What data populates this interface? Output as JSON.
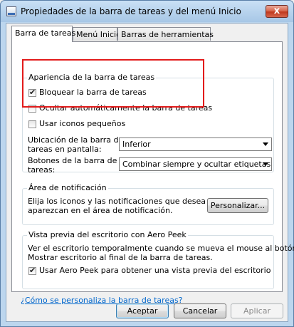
{
  "window": {
    "title": "Propiedades de la barra de tareas y del menú Inicio",
    "close_symbol": "x"
  },
  "tabs": [
    {
      "label": "Barra de tareas",
      "active": true
    },
    {
      "label": "Menú Inicio",
      "active": false
    },
    {
      "label": "Barras de herramientas",
      "active": false
    }
  ],
  "appearance": {
    "group_label": "Apariencia de la barra de tareas",
    "lock_label": "Bloquear la barra de tareas",
    "lock_checked": true,
    "autohide_label": "Ocultar automáticamente la barra de tareas",
    "autohide_checked": false,
    "small_icons_label": "Usar iconos pequeños",
    "small_icons_checked": false,
    "location_label_1": "Ubicación de la barra de",
    "location_label_2": "tareas en pantalla:",
    "location_value": "Inferior",
    "buttons_label_1": "Botones de la barra de",
    "buttons_label_2": "tareas:",
    "buttons_value": "Combinar siempre y ocultar etiquetas"
  },
  "notification": {
    "group_label": "Área de notificación",
    "text_1": "Elija los iconos y las notificaciones que desea que",
    "text_2": "aparezcan en el área de notificación.",
    "customize_button": "Personalizar..."
  },
  "peek": {
    "group_label": "Vista previa del escritorio con Aero Peek",
    "text_1": "Ver el escritorio temporalmente cuando se mueva el mouse al botón",
    "text_2": "Mostrar escritorio al final de la barra de tareas.",
    "use_peek_label": "Usar Aero Peek para obtener una vista previa del escritorio",
    "use_peek_checked": true
  },
  "help_link": "¿Cómo se personaliza la barra de tareas?",
  "footer": {
    "accept": "Aceptar",
    "cancel": "Cancelar",
    "apply": "Aplicar"
  },
  "colors": {
    "highlight_box": "#e21b1b",
    "link": "#0066cc"
  }
}
